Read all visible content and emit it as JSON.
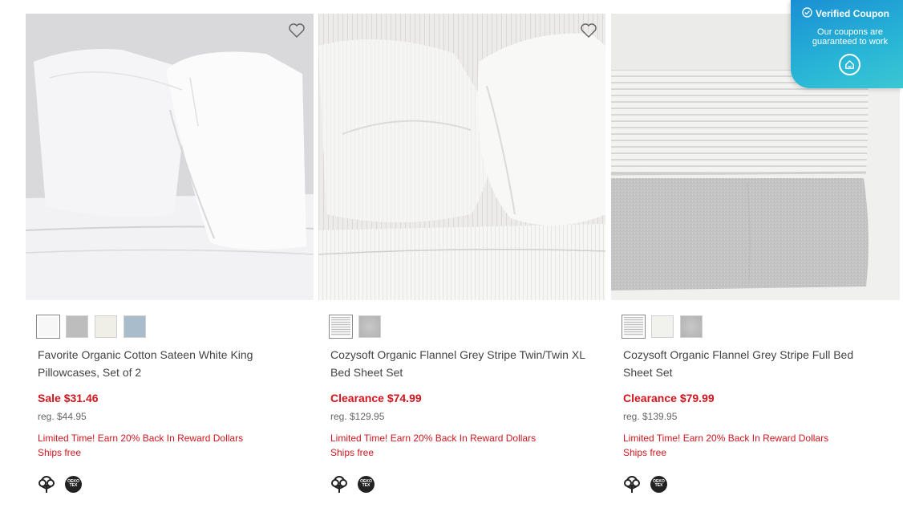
{
  "products": [
    {
      "name": "Favorite Organic Cotton Sateen White King Pillowcases, Set of 2",
      "price": "Sale $31.46",
      "regular_price": "reg. $44.95",
      "promo": "Limited Time! Earn 20% Back In Reward Dollars",
      "shipping": "Ships free",
      "swatches": [
        "#f7f7f7",
        "#bdbdbd",
        "#efefe8",
        "#a9bccb"
      ],
      "badges": [
        "organic-cotton-icon",
        "oeko-tex-icon"
      ]
    },
    {
      "name": "Cozysoft Organic Flannel Grey Stripe Twin/Twin XL Bed Sheet Set",
      "price": "Clearance $74.99",
      "regular_price": "reg. $129.95",
      "promo": "Limited Time! Earn 20% Back In Reward Dollars",
      "shipping": "Ships free",
      "swatches": [
        "grey-stripe",
        "heather-grey"
      ],
      "badges": [
        "organic-cotton-icon",
        "oeko-tex-icon"
      ]
    },
    {
      "name": "Cozysoft Organic Flannel Grey Stripe Full Bed Sheet Set",
      "price": "Clearance $79.99",
      "regular_price": "reg. $139.95",
      "promo": "Limited Time! Earn 20% Back In Reward Dollars",
      "shipping": "Ships free",
      "swatches": [
        "grey-stripe",
        "#f1f1ee",
        "heather-grey"
      ],
      "badges": [
        "organic-cotton-icon",
        "oeko-tex-icon"
      ]
    }
  ],
  "oeko_badge_text": "OEKO TEX",
  "coupon": {
    "title": "Verified Coupon",
    "subtitle": "Our coupons are guaranteed to work",
    "icon": "home-badge-icon"
  },
  "colors": {
    "sale_red": "#d1161e",
    "coupon_blue": "#1a8fd4",
    "coupon_teal": "#3cc7d3"
  }
}
